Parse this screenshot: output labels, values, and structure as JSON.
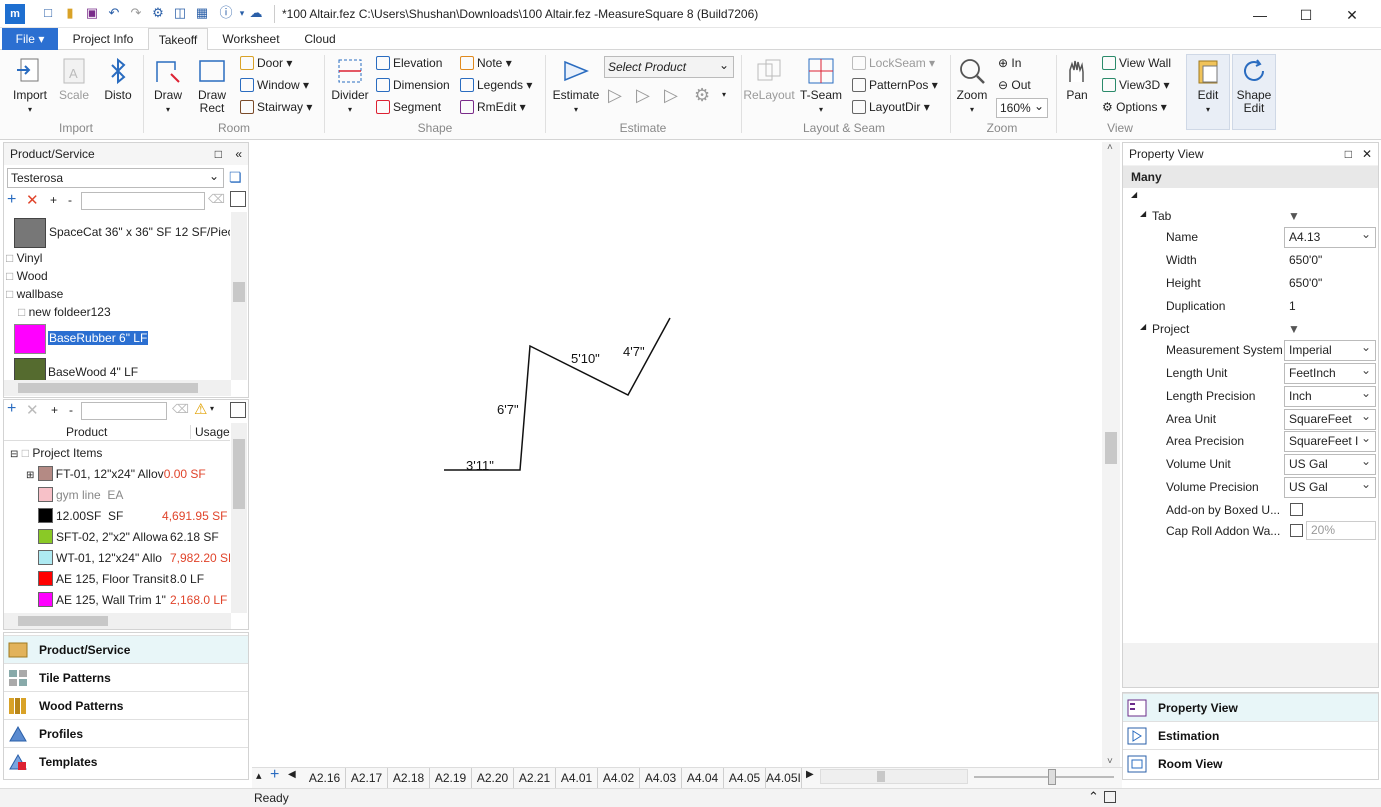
{
  "window": {
    "title": "*100 Altair.fez C:\\Users\\Shushan\\Downloads\\100 Altair.fez -MeasureSquare 8 (Build7206)",
    "minimize": "—",
    "maximize": "☐",
    "close": "✕"
  },
  "menu": {
    "file": "File",
    "tabs": [
      "Project Info",
      "Takeoff",
      "Worksheet",
      "Cloud"
    ]
  },
  "ribbon": {
    "import": {
      "import": "Import",
      "scale": "Scale",
      "disto": "Disto",
      "group": "Import"
    },
    "room": {
      "draw": "Draw",
      "draw_rect": "Draw Rect",
      "door": "Door",
      "window": "Window",
      "stairway": "Stairway",
      "group": "Room"
    },
    "shape": {
      "divider": "Divider",
      "elevation": "Elevation",
      "dimension": "Dimension",
      "segment": "Segment",
      "note": "Note",
      "legends": "Legends",
      "rmedit": "RmEdit",
      "group": "Shape"
    },
    "estimate": {
      "estimate": "Estimate",
      "select_product": "Select Product",
      "group": "Estimate"
    },
    "layout": {
      "relayout": "ReLayout",
      "tseam": "T-Seam",
      "lockseam": "LockSeam",
      "patternpos": "PatternPos",
      "layoutdir": "LayoutDir",
      "group": "Layout & Seam"
    },
    "zoom": {
      "zoom": "Zoom",
      "in": "In",
      "out": "Out",
      "level": "160%",
      "group": "Zoom"
    },
    "view": {
      "pan": "Pan",
      "view_wall": "View Wall",
      "view3d": "View3D",
      "options": "Options",
      "group": "View"
    },
    "edit": {
      "edit": "Edit",
      "shape_edit": "Shape Edit"
    }
  },
  "product_panel": {
    "title": "Product/Service",
    "catalog": "Testerosa",
    "tree": [
      {
        "label": "SpaceCat 36\" x 36\" SF 12 SF/Piece",
        "kind": "thumb"
      },
      {
        "label": "Vinyl",
        "kind": "doc"
      },
      {
        "label": "Wood",
        "kind": "doc"
      },
      {
        "label": "wallbase",
        "kind": "doc"
      },
      {
        "label": "new foldeer123",
        "kind": "folder"
      },
      {
        "label": "BaseRubber 6\" LF",
        "kind": "swatch",
        "color": "#ff00ff",
        "selected": true
      },
      {
        "label": "BaseWood 4\" LF",
        "kind": "swatch",
        "color": "#556b2f"
      }
    ]
  },
  "items_panel": {
    "col_product": "Product",
    "col_usage": "Usage",
    "root": "Project Items",
    "rows": [
      {
        "name": "FT-01, 12\"x24\" Allov",
        "usage": "0.00 SF",
        "color": "#b48a84",
        "red": true,
        "expander": true
      },
      {
        "name": "gym line",
        "usage": "EA",
        "color": "#f7c1c8",
        "gray": true
      },
      {
        "name": "12.00SF",
        "usage": "SF",
        "color": "#000000",
        "usage2": "4,691.95 SF"
      },
      {
        "name": "SFT-02, 2\"x2\" Allowa",
        "usage": "62.18 SF",
        "color": "#8ac926"
      },
      {
        "name": "WT-01, 12\"x24\" Allo",
        "usage": "7,982.20 SF",
        "color": "#aeeaf2",
        "red": true
      },
      {
        "name": "AE 125, Floor Transit",
        "usage": "8.0 LF",
        "color": "#ff0000"
      },
      {
        "name": "AE 125, Wall Trim 1\"",
        "usage": "2,168.0 LF",
        "color": "#ff00ff",
        "red": true
      }
    ]
  },
  "left_nav": [
    "Product/Service",
    "Tile Patterns",
    "Wood Patterns",
    "Profiles",
    "Templates"
  ],
  "drawing": {
    "dims": [
      "3'11\"",
      "6'7\"",
      "5'10\"",
      "4'7\""
    ]
  },
  "sheets": [
    "A2.16",
    "A2.17",
    "A2.18",
    "A2.19",
    "A2.20",
    "A2.21",
    "A4.01",
    "A4.02",
    "A4.03",
    "A4.04",
    "A4.05",
    "A4.05I"
  ],
  "status": "Ready",
  "property": {
    "title": "Property View",
    "selection": "Many",
    "tab_section": "Tab",
    "project_section": "Project",
    "rows": [
      {
        "label": "Name",
        "value": "A4.13",
        "dd": true
      },
      {
        "label": "Width",
        "value": "650'0\""
      },
      {
        "label": "Height",
        "value": "650'0\""
      },
      {
        "label": "Duplication",
        "value": "1"
      }
    ],
    "project_rows": [
      {
        "label": "Measurement System",
        "value": "Imperial",
        "dd": true
      },
      {
        "label": "Length Unit",
        "value": "FeetInch",
        "dd": true
      },
      {
        "label": "Length Precision",
        "value": "Inch",
        "dd": true
      },
      {
        "label": "Area Unit",
        "value": "SquareFeet",
        "dd": true
      },
      {
        "label": "Area Precision",
        "value": "SquareFeet I",
        "dd": true
      },
      {
        "label": "Volume Unit",
        "value": "US Gal",
        "dd": true
      },
      {
        "label": "Volume Precision",
        "value": "US Gal",
        "dd": true
      },
      {
        "label": "Add-on by Boxed U...",
        "value": "",
        "check": true
      },
      {
        "label": "Cap Roll Addon Wa...",
        "value": "20%",
        "check": true
      }
    ]
  },
  "right_nav": [
    "Property View",
    "Estimation",
    "Room View"
  ]
}
